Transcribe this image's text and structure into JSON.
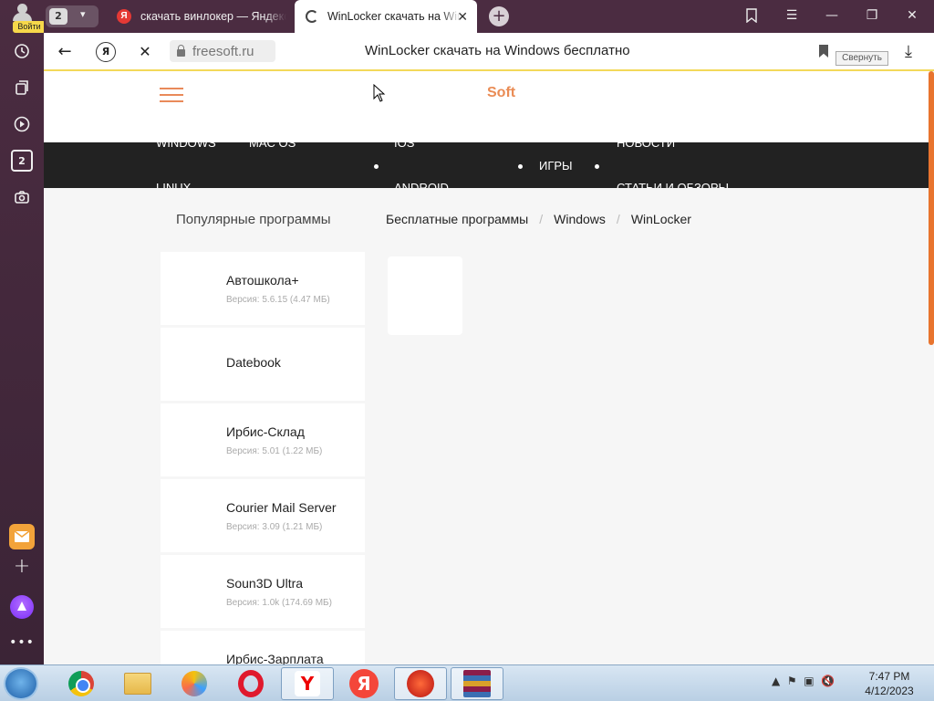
{
  "rail": {
    "login_label": "Войти",
    "tab_badge": "2",
    "icons": [
      "history-icon",
      "collections-icon",
      "video-icon",
      "tabs-count-icon",
      "screenshot-icon",
      "mail-icon",
      "add-icon",
      "alice-icon",
      "more-icon"
    ]
  },
  "tabs": {
    "count": "2",
    "items": [
      {
        "title": "скачать винлокер — Яндекс",
        "favicon": "Я"
      },
      {
        "title": "WinLocker скачать на Windows",
        "active": true
      }
    ]
  },
  "address_bar": {
    "host": "freesoft.ru",
    "page_title": "WinLocker скачать на Windows бесплатно",
    "tooltip": "Свернуть",
    "yandex_button": "Я"
  },
  "site": {
    "brand": "Soft",
    "accent_color": "#ea8c55",
    "nav": [
      "WINDOWS",
      "MAC OS",
      "IOS",
      "ANDROID",
      "ИГРЫ",
      "НОВОСТИ",
      "СТАТЬИ И ОБЗОРЫ",
      "LINUX"
    ],
    "sidebar_title": "Популярные программы",
    "breadcrumbs": [
      "Бесплатные программы",
      "Windows",
      "WinLocker"
    ],
    "breadcrumb_separator": "/",
    "programs": [
      {
        "name": "Автошкола+",
        "version": "Версия: 5.6.15 (4.47 МБ)"
      },
      {
        "name": "Datebook",
        "version": ""
      },
      {
        "name": "Ирбис-Склад",
        "version": "Версия: 5.01 (1.22 МБ)"
      },
      {
        "name": "Courier Mail Server",
        "version": "Версия: 3.09 (1.21 МБ)"
      },
      {
        "name": "Soun3D Ultra",
        "version": "Версия: 1.0k (174.69 МБ)"
      },
      {
        "name": "Ирбис-Зарплата",
        "version": ""
      }
    ]
  },
  "taskbar": {
    "apps": [
      "chrome-icon",
      "explorer-icon",
      "yandex-tab-icon",
      "opera-icon",
      "yandex-browser-icon",
      "yandex-icon",
      "wot-icon",
      "winrar-icon"
    ],
    "time": "7:47 PM",
    "date": "4/12/2023"
  }
}
